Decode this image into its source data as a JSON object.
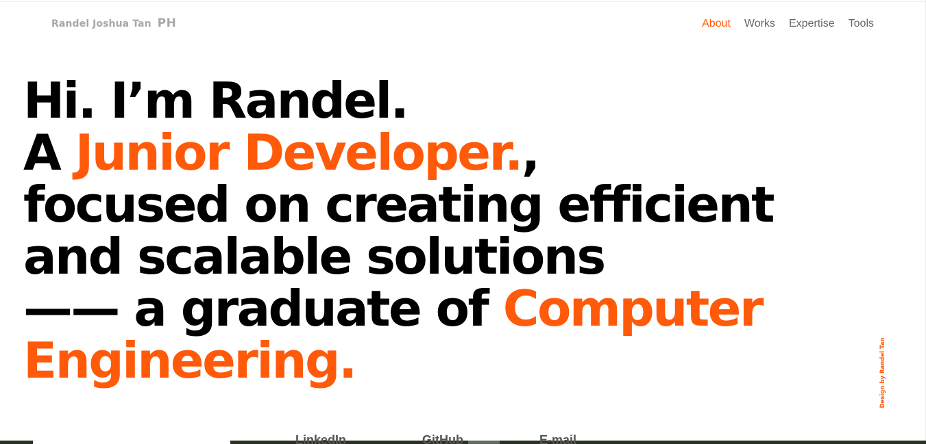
{
  "brand": {
    "name": "Randel Joshua Tan",
    "country": "PH"
  },
  "nav": {
    "items": [
      {
        "label": "About",
        "active": true
      },
      {
        "label": "Works",
        "active": false
      },
      {
        "label": "Expertise",
        "active": false
      },
      {
        "label": "Tools",
        "active": false
      }
    ]
  },
  "hero": {
    "line1": "Hi. I’m Randel.",
    "line2_prefix": "A ",
    "line2_role": "Junior Developer.",
    "line2_suffix": ",",
    "line3": "focused on creating efficient",
    "line4": "and scalable solutions",
    "line5_prefix": "—— a graduate of ",
    "line5_field": "Computer",
    "line6_field": "Engineering."
  },
  "credit": {
    "text": "Design by Randel Tan"
  },
  "social": {
    "links": [
      {
        "label": "LinkedIn"
      },
      {
        "label": "GitHub"
      },
      {
        "label": "E-mail"
      }
    ]
  },
  "colors": {
    "accent": "#ff5a0a",
    "text": "#000000",
    "muted": "#a8a8a8",
    "nav": "#666666",
    "background": "#ffffff"
  }
}
